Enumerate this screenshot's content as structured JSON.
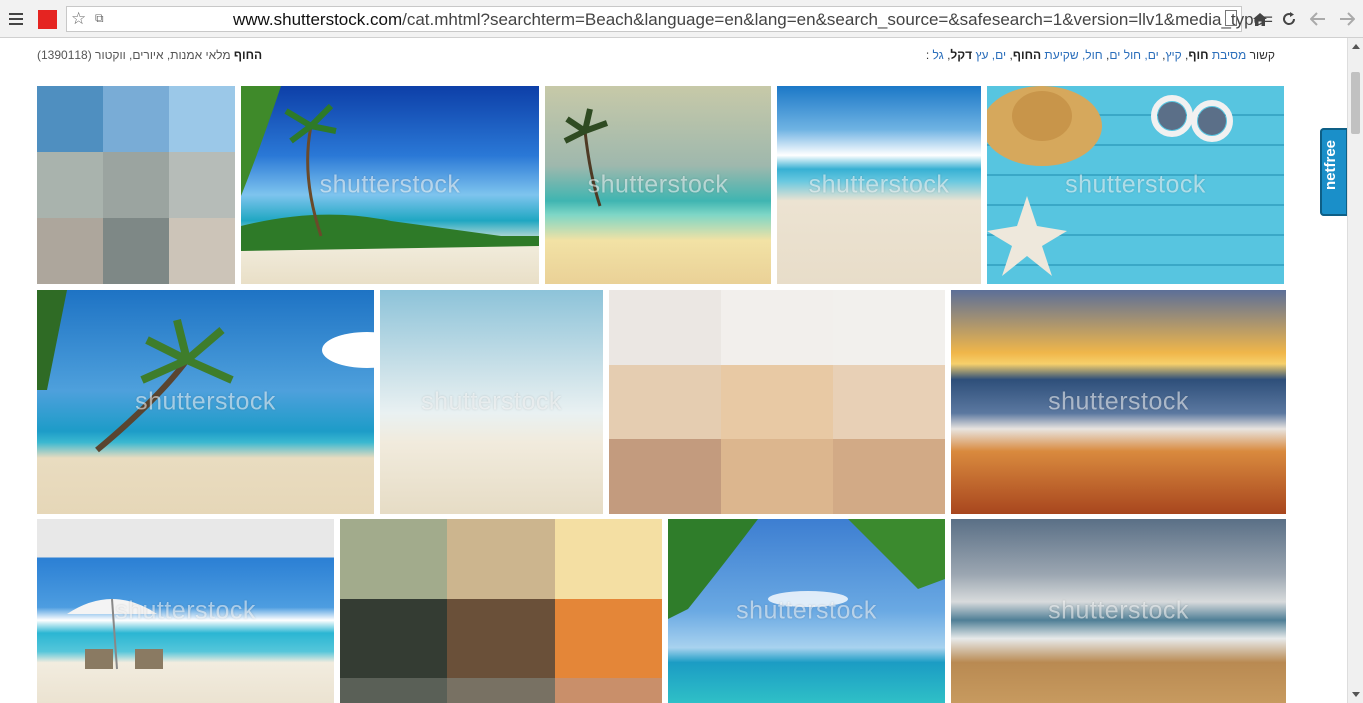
{
  "browser": {
    "url_host": "www.shutterstock.com",
    "url_rest": "/cat.mhtml?searchterm=Beach&language=en&lang=en&search_source=&safesearch=1&version=llv1&media_type=",
    "icons": [
      "menu-icon",
      "favicon-icon",
      "star-icon",
      "permissions-icon",
      "page-icon",
      "home-icon",
      "reload-icon",
      "back-icon",
      "forward-icon"
    ]
  },
  "related": {
    "prefix": "קשור",
    "items": [
      {
        "pre": "מסיבת ",
        "bold": "חוף",
        "sep": ", "
      },
      {
        "pre": "קיץ",
        "bold": "",
        "sep": ", "
      },
      {
        "pre": "ים, חול ים",
        "bold": "",
        "sep": ", "
      },
      {
        "pre": "חול, שקיעת ",
        "bold": "החוף",
        "sep": ", "
      },
      {
        "pre": "ים, עץ ",
        "bold": "דקל",
        "sep": ", "
      },
      {
        "pre": "גל",
        "bold": "",
        "sep": " :"
      }
    ]
  },
  "results": {
    "open_paren": "(",
    "bold": "החוף",
    "rest": " מלאי אמנות, איורים, ווקטור (1390118"
  },
  "watermark": "shutterstock",
  "netfree_label": "netfree",
  "palettes": {
    "p1": [
      "#4f8fc0",
      "#79acd6",
      "#9bc8e8",
      "#a9b3ad",
      "#9ba4a0",
      "#b6bcb8",
      "#ada69c",
      "#7e8886",
      "#ccc4b8"
    ],
    "p2": [
      "#ebe7e3",
      "#f2efec",
      "#f2f0ed",
      "#e5cdb1",
      "#e8c9a4",
      "#e8d0b6",
      "#c39b7e",
      "#dcb68e",
      "#d2aa86"
    ],
    "p3": [
      "#a2ab8c",
      "#ccb58e",
      "#f4dfa3",
      "#343c33",
      "#6a5039",
      "#e48638",
      "#5a6057",
      "#787163",
      "#c98f6a"
    ]
  }
}
